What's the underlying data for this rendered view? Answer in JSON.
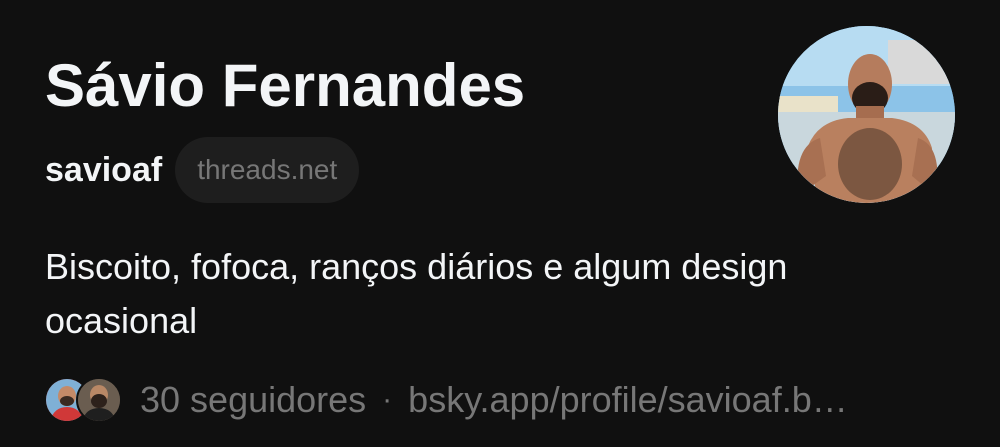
{
  "profile": {
    "display_name": "Sávio Fernandes",
    "handle": "savioaf",
    "domain_chip": "threads.net",
    "bio": "Biscoito, fofoca, ranços diários e algum design ocasional",
    "avatar_icon": "profile-photo",
    "followers_label": "30 seguidores",
    "separator": "·",
    "link": "bsky.app/profile/savioaf.b…"
  }
}
